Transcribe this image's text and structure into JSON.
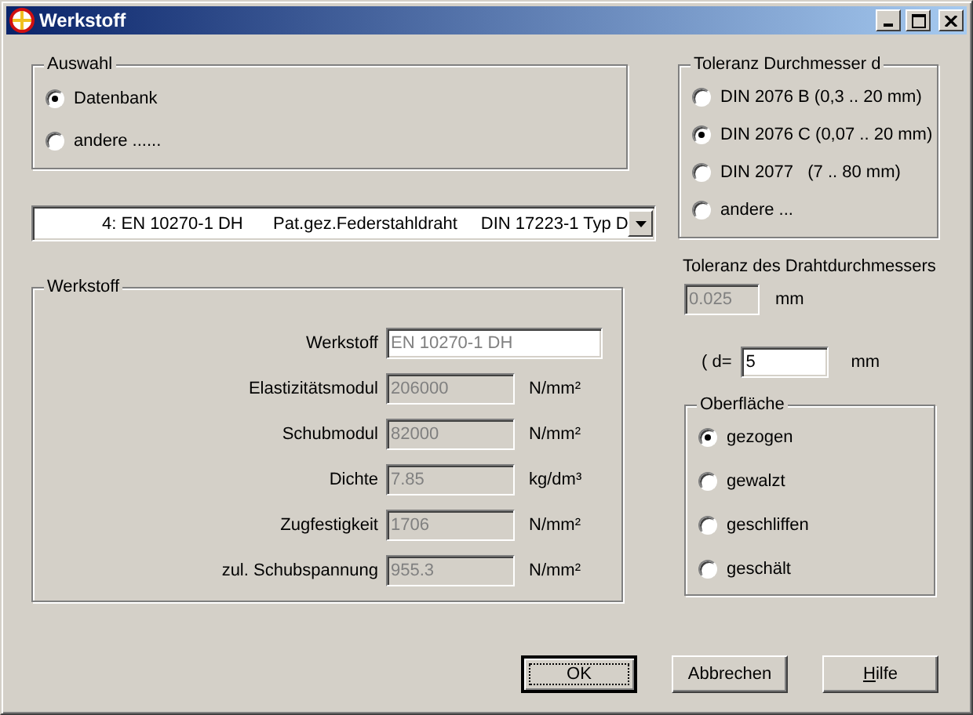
{
  "window": {
    "title": "Werkstoff"
  },
  "auswahl": {
    "title": "Auswahl",
    "options": [
      {
        "label": "Datenbank",
        "selected": true
      },
      {
        "label": "andere ......",
        "selected": false
      }
    ]
  },
  "material_combo": {
    "number": "4: EN 10270-1 DH",
    "description": "Pat.gez.Federstahldraht",
    "standard": "DIN 17223-1 Typ D"
  },
  "werkstoff": {
    "title": "Werkstoff",
    "fields": [
      {
        "label": "Werkstoff",
        "value": "EN 10270-1 DH",
        "read_only": true,
        "disabled": false
      },
      {
        "label": "Elastizitätsmodul",
        "value": "206000",
        "unit": "N/mm²",
        "disabled": true
      },
      {
        "label": "Schubmodul",
        "value": "82000",
        "unit": "N/mm²",
        "disabled": true
      },
      {
        "label": "Dichte",
        "value": "7.85",
        "unit": "kg/dm³",
        "disabled": true
      },
      {
        "label": "Zugfestigkeit",
        "value": "1706",
        "unit": "N/mm²",
        "disabled": true
      },
      {
        "label": "zul. Schubspannung",
        "value": "955.3",
        "unit": "N/mm²",
        "disabled": true
      }
    ]
  },
  "toleranz_durchmesser": {
    "title": "Toleranz Durchmesser d",
    "options": [
      {
        "label": "DIN 2076 B (0,3 .. 20 mm)",
        "selected": false
      },
      {
        "label": "DIN 2076 C (0,07 .. 20 mm)",
        "selected": true
      },
      {
        "label": "DIN 2077   (7 .. 80 mm)",
        "selected": false
      },
      {
        "label": "andere ...",
        "selected": false
      }
    ]
  },
  "toleranz_draht": {
    "label": "Toleranz des Drahtdurchmessers",
    "value": "0.025",
    "unit": "mm",
    "disabled": true
  },
  "diameter": {
    "label": "( d=",
    "value": "5",
    "unit": "mm",
    "disabled": false
  },
  "oberflaeche": {
    "title": "Oberfläche",
    "options": [
      {
        "label": "gezogen",
        "selected": true
      },
      {
        "label": "gewalzt",
        "selected": false
      },
      {
        "label": "geschliffen",
        "selected": false
      },
      {
        "label": "geschält",
        "selected": false
      }
    ]
  },
  "buttons": [
    {
      "label": "OK",
      "default": true,
      "mnemonic": false
    },
    {
      "label": "Abbrechen",
      "default": false,
      "mnemonic": false
    },
    {
      "label": "Hilfe",
      "default": false,
      "mnemonic": true
    }
  ]
}
